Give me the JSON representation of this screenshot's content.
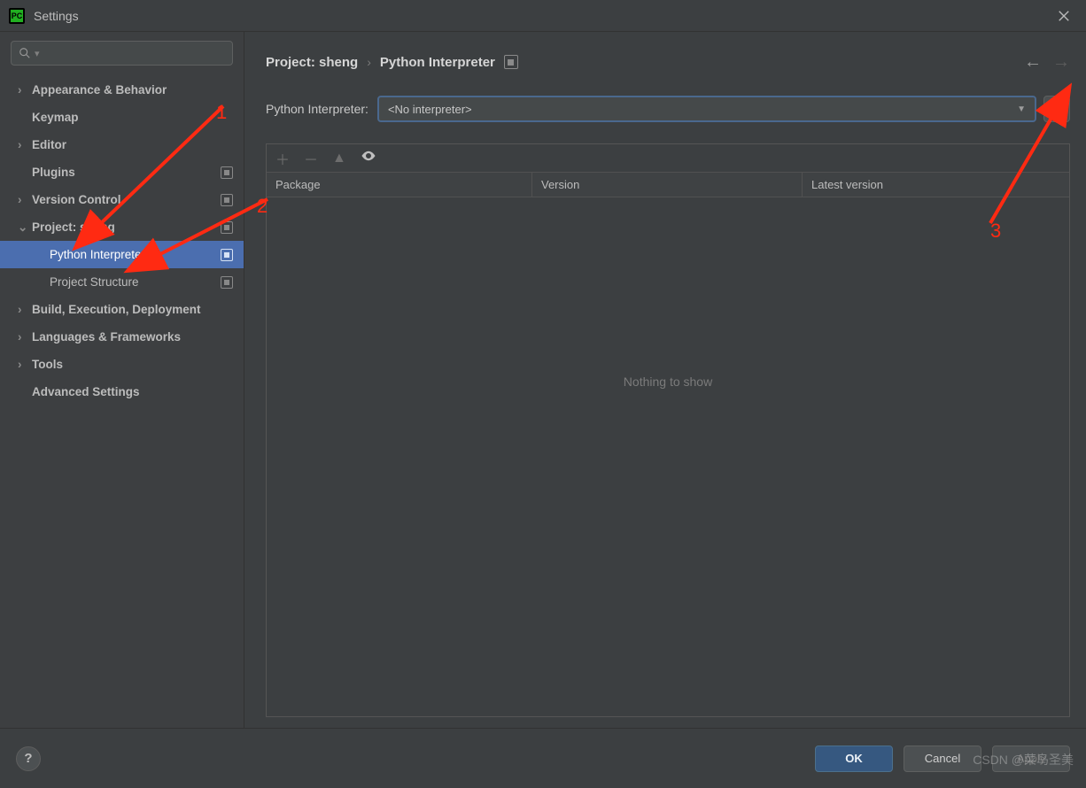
{
  "window": {
    "title": "Settings"
  },
  "sidebar": {
    "search_placeholder": "",
    "items": [
      {
        "label": "Appearance & Behavior",
        "expandable": true,
        "expanded": false
      },
      {
        "label": "Keymap",
        "expandable": false
      },
      {
        "label": "Editor",
        "expandable": true,
        "expanded": false
      },
      {
        "label": "Plugins",
        "expandable": false,
        "badge": true
      },
      {
        "label": "Version Control",
        "expandable": true,
        "expanded": false,
        "badge": true
      },
      {
        "label": "Project: sheng",
        "expandable": true,
        "expanded": true,
        "badge": true,
        "children": [
          {
            "label": "Python Interpreter",
            "badge": true,
            "selected": true
          },
          {
            "label": "Project Structure",
            "badge": true
          }
        ]
      },
      {
        "label": "Build, Execution, Deployment",
        "expandable": true,
        "expanded": false
      },
      {
        "label": "Languages & Frameworks",
        "expandable": true,
        "expanded": false
      },
      {
        "label": "Tools",
        "expandable": true,
        "expanded": false
      },
      {
        "label": "Advanced Settings",
        "expandable": false
      }
    ]
  },
  "breadcrumb": {
    "project": "Project: sheng",
    "page": "Python Interpreter"
  },
  "interpreter": {
    "label": "Python Interpreter:",
    "value": "<No interpreter>"
  },
  "packages": {
    "columns": {
      "package": "Package",
      "version": "Version",
      "latest": "Latest version"
    },
    "empty_text": "Nothing to show"
  },
  "footer": {
    "ok": "OK",
    "cancel": "Cancel",
    "apply": "Apply"
  },
  "annotations": {
    "one": "1",
    "two": "2",
    "three": "3"
  },
  "watermark": "CSDN @菜鸟圣美"
}
